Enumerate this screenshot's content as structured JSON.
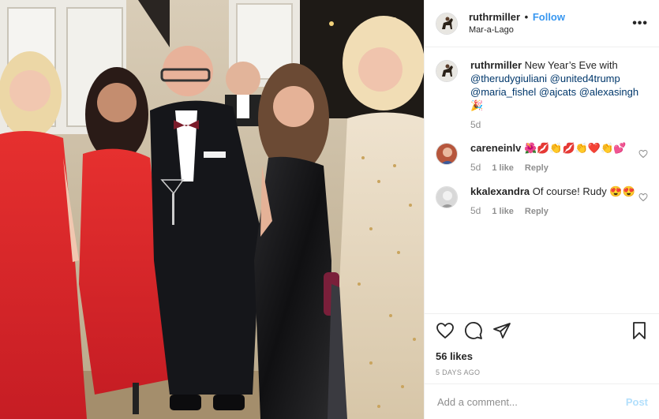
{
  "header": {
    "username": "ruthrmiller",
    "separator": "•",
    "follow_label": "Follow",
    "location": "Mar-a-Lago",
    "more_icon": "more-options-icon"
  },
  "caption": {
    "username": "ruthrmiller",
    "text": "New Year’s Eve with",
    "mentions": [
      "@therudygiuliani",
      "@united4trump",
      "@maria_fishel",
      "@ajcats",
      "@alexasingh"
    ],
    "emoji": "🎉",
    "time": "5d"
  },
  "comments": [
    {
      "username": "careneinlv",
      "text": "🌺💋👏💋👏❤️👏💕",
      "time": "5d",
      "likes": "1 like",
      "reply": "Reply"
    },
    {
      "username": "kkalexandra",
      "text": "Of course! Rudy 😍😍",
      "time": "5d",
      "likes": "1 like",
      "reply": "Reply"
    }
  ],
  "actions": {
    "like_icon": "heart-icon",
    "comment_icon": "comment-icon",
    "share_icon": "share-icon",
    "save_icon": "bookmark-icon",
    "likes_count": "56 likes",
    "time_ago": "5 DAYS AGO"
  },
  "add_comment": {
    "placeholder": "Add a comment...",
    "post_label": "Post"
  },
  "colors": {
    "link_blue": "#3897f0",
    "mention_blue": "#00376b",
    "muted": "#8e8e8e",
    "post_disabled": "#b2dffc"
  }
}
